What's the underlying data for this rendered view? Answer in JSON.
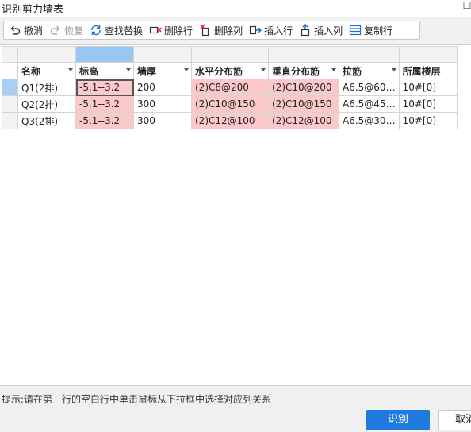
{
  "window": {
    "title": "识别剪力墙表"
  },
  "toolbar": {
    "undo": "撤消",
    "redo": "恢复",
    "find_replace": "查找替换",
    "delete_row": "删除行",
    "delete_col": "删除列",
    "insert_row": "插入行",
    "insert_col": "插入列",
    "copy_row": "复制行"
  },
  "table": {
    "headers": [
      "名称",
      "标高",
      "墙厚",
      "水平分布筋",
      "垂直分布筋",
      "拉筋",
      "所属楼层"
    ],
    "rows": [
      [
        "Q1(2排)",
        "-5.1--3.2",
        "200",
        "(2)C8@200",
        "(2)C10@200",
        "A6.5@60…",
        "10#[0]"
      ],
      [
        "Q2(2排)",
        "-5.1--3.2",
        "300",
        "(2)C10@150",
        "(2)C10@150",
        "A6.5@45…",
        "10#[0]"
      ],
      [
        "Q3(2排)",
        "-5.1--3.2",
        "300",
        "(2)C12@100",
        "(2)C12@100",
        "A6.5@30…",
        "10#[0]"
      ]
    ]
  },
  "hint": "提示:请在第一行的空白行中单击鼠标从下拉框中选择对应列关系",
  "buttons": {
    "ok": "识别",
    "cancel": "取消"
  },
  "colors": {
    "highlight_pink": "#fbc9c9",
    "selected_blue": "#99c7f5",
    "primary_button": "#1f7ae0"
  }
}
